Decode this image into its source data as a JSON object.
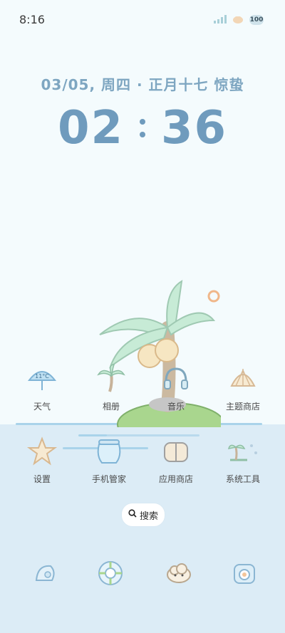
{
  "status_bar": {
    "time": "8:16",
    "battery": "100"
  },
  "lock": {
    "date": "03/05, 周四 · 正月十七 惊蛰",
    "hours": "02",
    "minutes": "36"
  },
  "weather_icon_text": "11°C",
  "apps": [
    {
      "label": "天气",
      "icon": "umbrella-weather-icon"
    },
    {
      "label": "相册",
      "icon": "palm-tree-icon"
    },
    {
      "label": "音乐",
      "icon": "headphones-icon"
    },
    {
      "label": "主题商店",
      "icon": "shell-icon"
    },
    {
      "label": "设置",
      "icon": "starfish-icon"
    },
    {
      "label": "手机管家",
      "icon": "jar-icon"
    },
    {
      "label": "应用商店",
      "icon": "box-icon"
    },
    {
      "label": "系统工具",
      "icon": "island-tools-icon"
    }
  ],
  "search": {
    "label": "搜索"
  },
  "dock": [
    {
      "icon": "seashell-phone-icon"
    },
    {
      "icon": "lifebuoy-icon"
    },
    {
      "icon": "cloud-chat-icon"
    },
    {
      "icon": "camera-icon"
    }
  ],
  "colors": {
    "accent": "#6f9bbd",
    "sea": "#dcecf6",
    "background": "#f4fbfd"
  }
}
